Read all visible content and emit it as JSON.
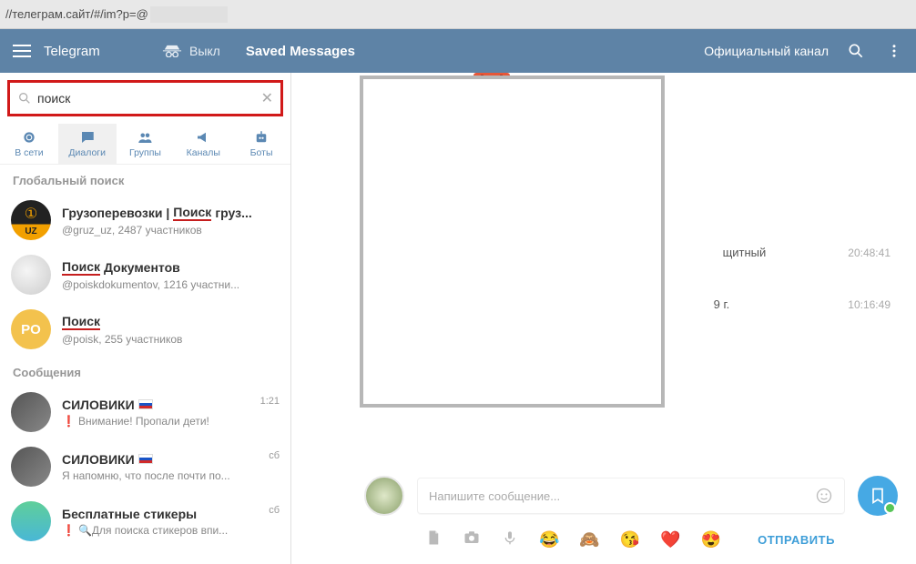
{
  "url": "//телеграм.сайт/#/im?p=@",
  "header": {
    "brand": "Telegram",
    "exit": "Выкл",
    "chat_title": "Saved Messages",
    "channel": "Официальный канал"
  },
  "search": {
    "value": "поиск",
    "placeholder": "поиск"
  },
  "tabs": {
    "online": "В сети",
    "dialogs": "Диалоги",
    "groups": "Группы",
    "channels": "Каналы",
    "bots": "Боты"
  },
  "sections": {
    "global": "Глобальный поиск",
    "messages": "Сообщения"
  },
  "global_results": [
    {
      "title_pre": "Грузоперевозки | ",
      "title_hl": "Поиск",
      "title_post": " груз...",
      "sub": "@gruz_uz, 2487 участников"
    },
    {
      "title_pre": "",
      "title_hl": "Поиск",
      "title_post": " Документов",
      "sub": "@poiskdokumentov, 1216 участни..."
    },
    {
      "title_pre": "",
      "title_hl": "Поиск",
      "title_post": "",
      "sub": "@poisk, 255 участников",
      "avatar_text": "PO"
    }
  ],
  "message_results": [
    {
      "title": "СИЛОВИКИ",
      "flag": true,
      "sub_pre": "Внимание! Пропали дети!",
      "time": "1:21",
      "excl": true
    },
    {
      "title": "СИЛОВИКИ",
      "flag": true,
      "sub_pre": "Я напомню, что после почти по...",
      "time": "сб"
    },
    {
      "title": "Бесплатные стикеры",
      "sub_loupe": true,
      "sub_pre": "Для ",
      "sub_hl": "поиска",
      "sub_post": " стикеров впи...",
      "time": "сб",
      "excl": true
    }
  ],
  "chat": {
    "meta_text_1": "щитный",
    "meta_time_1": "20:48:41",
    "meta_text_2": "9 г.",
    "meta_time_2": "10:16:49",
    "compose_placeholder": "Напишите сообщение...",
    "send": "ОТПРАВИТЬ",
    "emoji": [
      "😂",
      "🙈",
      "😘",
      "❤️",
      "😍"
    ]
  }
}
